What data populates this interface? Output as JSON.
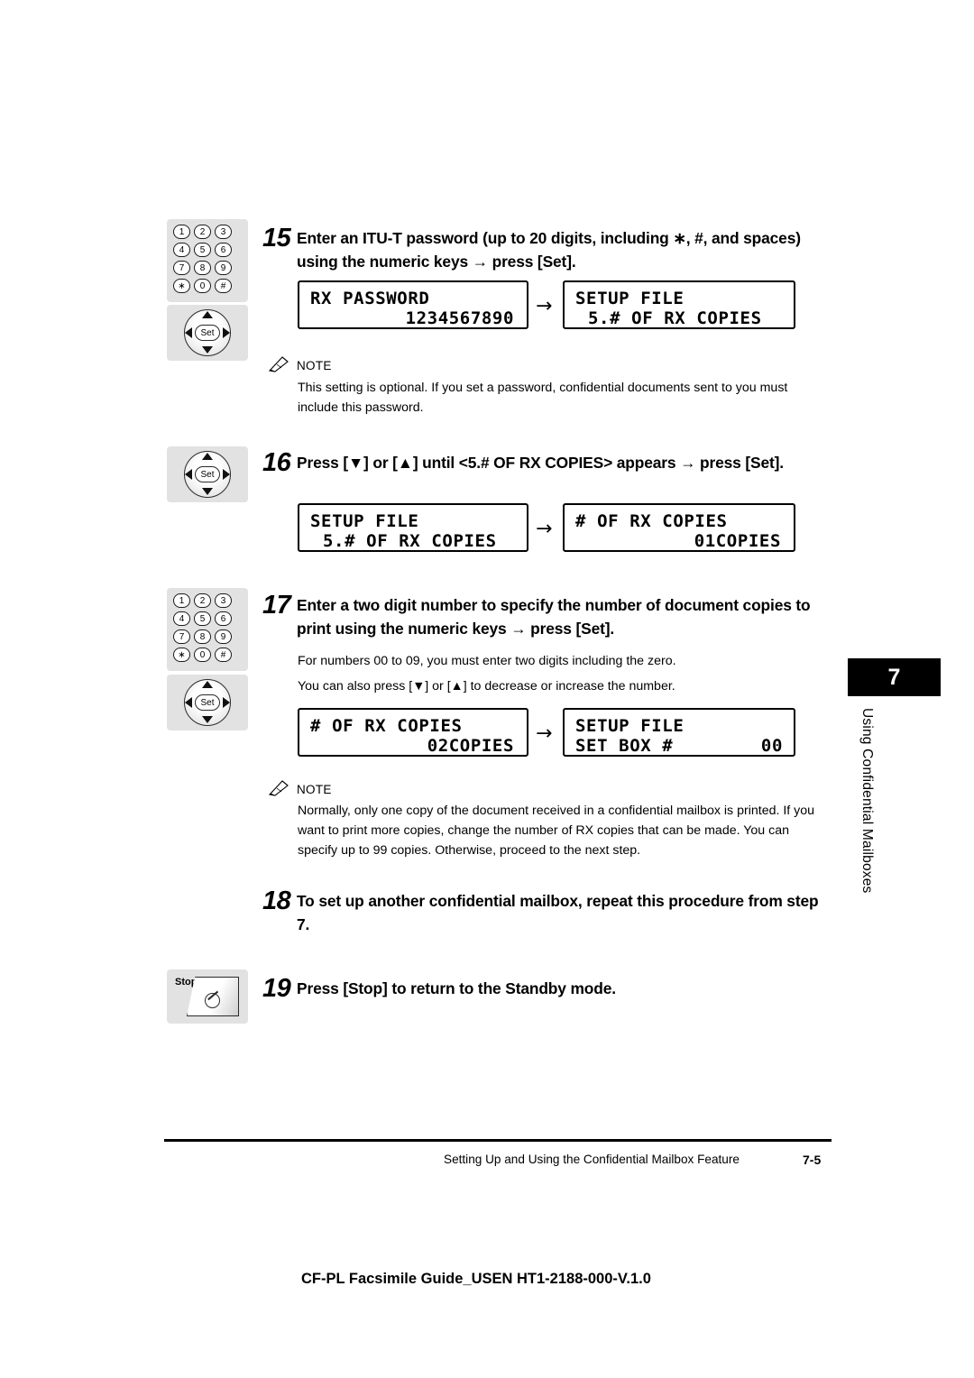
{
  "steps": [
    {
      "number": "15",
      "text": "Enter an ITU-T password (up to 20 digits, including ∗, #, and spaces) using the numeric keys → press [Set].",
      "icons": [
        "numeric-keypad",
        "set-dial"
      ],
      "lcd_left": {
        "line1": "RX PASSWORD",
        "line2": "1234567890"
      },
      "lcd_right": {
        "line1": "SETUP FILE",
        "line2": "5.# OF RX COPIES"
      },
      "arrow": "→",
      "note": {
        "label": "NOTE",
        "body": "This setting is optional. If you set a password, confidential documents sent to you must include this password."
      }
    },
    {
      "number": "16",
      "text": "Press [▼] or [▲] until <5.# OF RX COPIES> appears → press [Set].",
      "icons": [
        "set-dial"
      ],
      "lcd_left": {
        "line1": "SETUP FILE",
        "line2": "5.# OF RX COPIES"
      },
      "lcd_right": {
        "line1": "# OF RX COPIES",
        "line2": "01COPIES"
      },
      "arrow": "→"
    },
    {
      "number": "17",
      "text": "Enter a two digit number to specify the number of document copies to print using the numeric keys → press [Set].",
      "icons": [
        "numeric-keypad",
        "set-dial"
      ],
      "body_lines": [
        "For numbers 00 to 09, you must enter two digits including the zero.",
        "You can also press [▼] or [▲] to decrease or increase the number."
      ],
      "lcd_left": {
        "line1": "# OF RX COPIES",
        "line2": "02COPIES"
      },
      "lcd_right": {
        "line1": "SETUP FILE",
        "line2a": "SET BOX #",
        "line2b": "00"
      },
      "arrow": "→",
      "note": {
        "label": "NOTE",
        "body": "Normally, only one copy of the document received in a confidential mailbox is printed. If you want to print more copies, change the number of RX copies that can be made. You can specify up to 99 copies. Otherwise, proceed to the next step."
      }
    },
    {
      "number": "18",
      "text": "To set up another confidential mailbox, repeat this procedure from step 7.",
      "icons": []
    },
    {
      "number": "19",
      "text": "Press [Stop] to return to the Standby mode.",
      "icons": [
        "stop-key"
      ]
    }
  ],
  "keypad_keys": [
    "1",
    "2",
    "3",
    "4",
    "5",
    "6",
    "7",
    "8",
    "9",
    "∗",
    "0",
    "#"
  ],
  "dial_label": "Set",
  "stop_label": "Stop",
  "chapter_tab": "7",
  "side_title": "Using Confidential Mailboxes",
  "footer": {
    "text": "Setting Up and Using the Confidential Mailbox Feature",
    "page": "7-5"
  },
  "doc_id": "CF-PL Facsimile Guide_USEN HT1-2188-000-V.1.0"
}
